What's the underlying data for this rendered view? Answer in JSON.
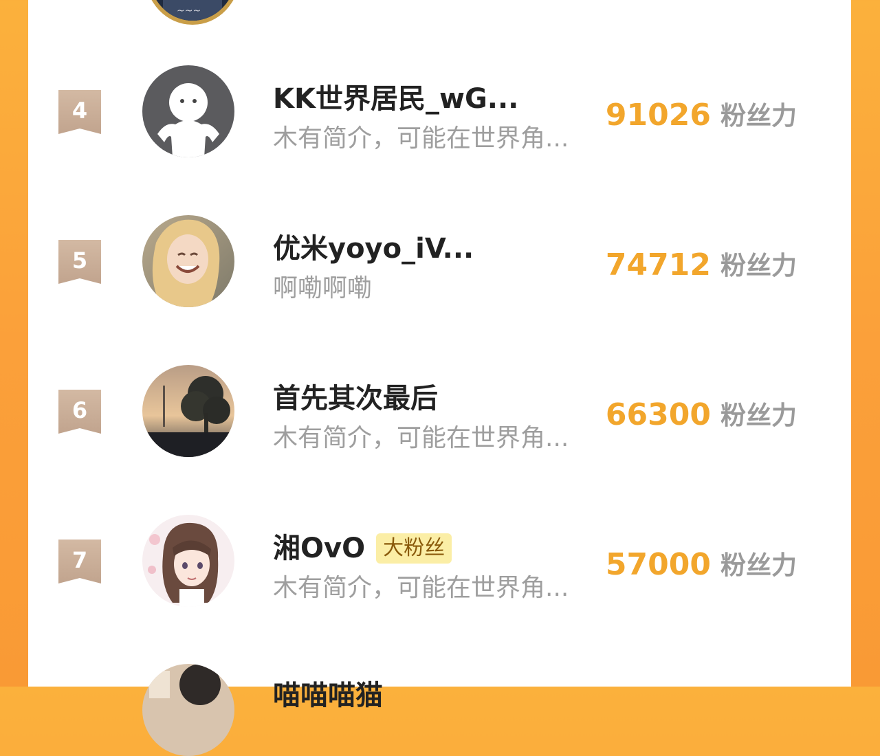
{
  "colors": {
    "background": "#fba83a",
    "panel": "#ffffff",
    "score": "#f2a62c",
    "rank_badge": "#c9ad98",
    "tag_bg": "#fbeea6",
    "tag_text": "#8a5a0b"
  },
  "leaderboard": {
    "rows": [
      {
        "rank": "4",
        "name": "KK世界居民_wG...",
        "bio": "木有简介，可能在世界角...",
        "score": "91026",
        "unit": "粉丝力",
        "avatar": "default-person-avatar"
      },
      {
        "rank": "5",
        "name": "优米yoyo_iV...",
        "bio": "啊嘞啊嘞",
        "score": "74712",
        "unit": "粉丝力",
        "avatar": "blonde-girl-photo-avatar"
      },
      {
        "rank": "6",
        "name": "首先其次最后",
        "bio": "木有简介，可能在世界角...",
        "score": "66300",
        "unit": "粉丝力",
        "avatar": "sunset-tree-photo-avatar"
      },
      {
        "rank": "7",
        "name": "湘OvO",
        "tag": "大粉丝",
        "bio": "木有简介，可能在世界角...",
        "score": "57000",
        "unit": "粉丝力",
        "avatar": "anime-girl-avatar"
      }
    ],
    "next_partial_name": "喵喵喵猫"
  }
}
